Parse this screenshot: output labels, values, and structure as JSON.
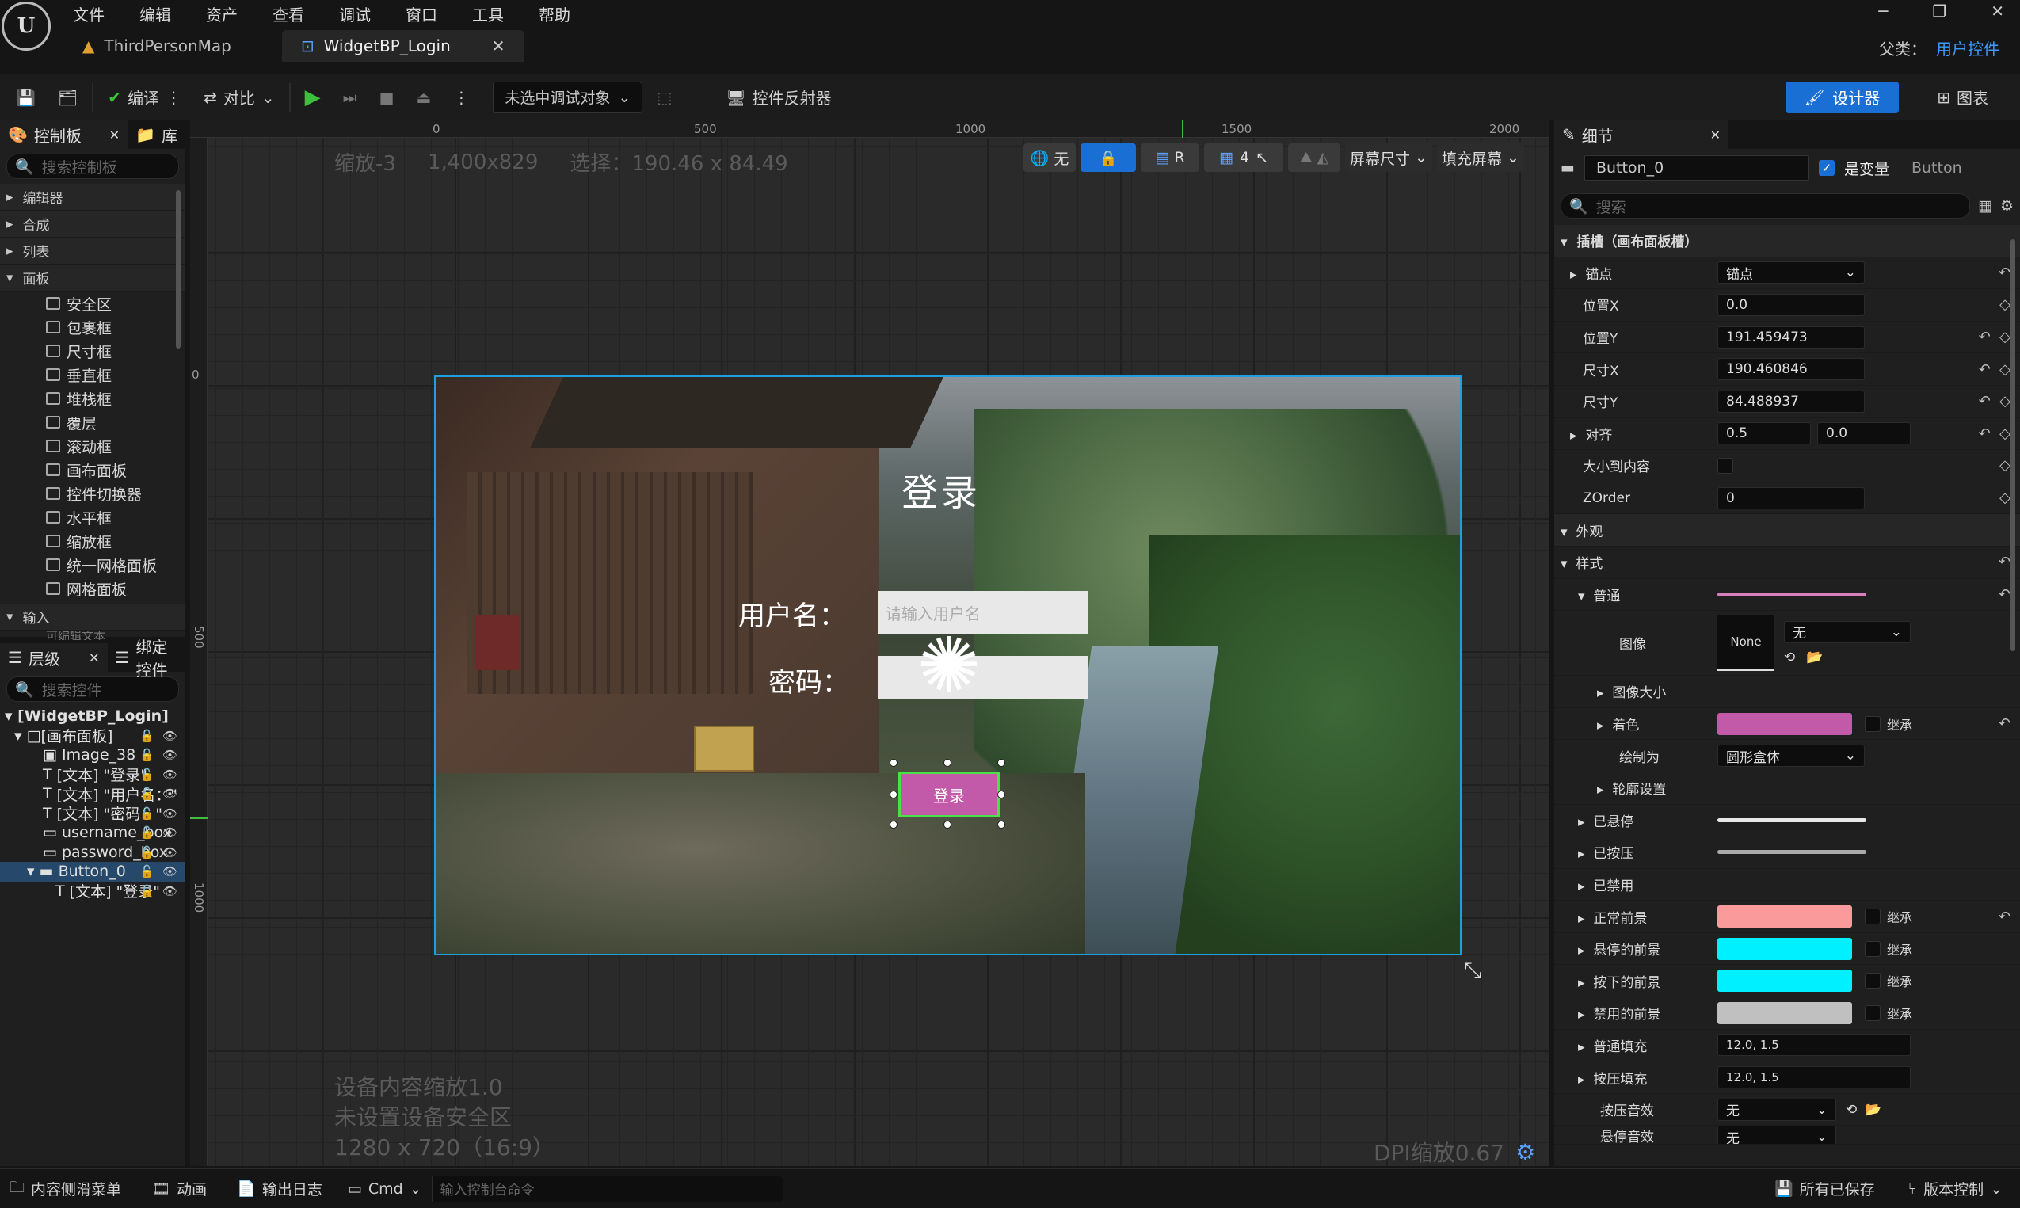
{
  "menu": [
    "文件",
    "编辑",
    "资产",
    "查看",
    "调试",
    "窗口",
    "工具",
    "帮助"
  ],
  "tabs": [
    {
      "label": "ThirdPersonMap"
    },
    {
      "label": "WidgetBP_Login"
    }
  ],
  "window": {
    "parent_label": "父类：",
    "parent_value": "用户控件"
  },
  "toolbar": {
    "compile": "编译",
    "diff": "对比",
    "debug_target": "未选中调试对象",
    "reflector": "控件反射器",
    "designer": "设计器",
    "graph": "图表"
  },
  "palette": {
    "tab": "控制板",
    "lib_tab": "库",
    "search_placeholder": "搜索控制板",
    "categories": [
      "编辑器",
      "合成",
      "列表",
      "面板"
    ],
    "items": [
      "安全区",
      "包裹框",
      "尺寸框",
      "垂直框",
      "堆栈框",
      "覆层",
      "滚动框",
      "画布面板",
      "控件切换器",
      "水平框",
      "缩放框",
      "统一网格面板",
      "网格面板"
    ],
    "input_category": "输入",
    "partial": "可编辑文本"
  },
  "hierarchy": {
    "tab": "层级",
    "bind_tab": "绑定控件",
    "search_placeholder": "搜索控件",
    "rows": [
      "[WidgetBP_Login]",
      "[画布面板]",
      "Image_38",
      "[文本] \"登录\"",
      "[文本] \"用户名：\"",
      "[文本] \"密码：\"",
      "username_box",
      "password_box",
      "Button_0",
      "[文本] \"登录\""
    ]
  },
  "viewport": {
    "zoom": "缩放-3",
    "resolution": "1,400x829",
    "selection": "选择：190.46 x 84.49",
    "tools": {
      "none": "无",
      "r": "R",
      "grid_num": "4",
      "screen_size": "屏幕尺寸",
      "fill_screen": "填充屏幕"
    },
    "ruler_x": [
      "0",
      "500",
      "1000",
      "1500",
      "2000"
    ],
    "ruler_y": [
      "0",
      "500",
      "1000"
    ],
    "device_scale": "设备内容缩放1.0",
    "safe_zone": "未设置设备安全区",
    "res_ratio": "1280 x 720（16:9）",
    "dpi": "DPI缩放0.67"
  },
  "canvas": {
    "title": "登录",
    "username_label": "用户名：",
    "password_label": "密码：",
    "username_placeholder": "请输入用户名",
    "button_text": "登录"
  },
  "details": {
    "tab": "细节",
    "widget_name": "Button_0",
    "is_variable": "是变量",
    "widget_type": "Button",
    "search_placeholder": "搜索",
    "slot_section": "插槽（画布面板槽）",
    "anchor_label": "锚点",
    "anchor_value": "锚点",
    "pos_x_label": "位置X",
    "pos_x": "0.0",
    "pos_y_label": "位置Y",
    "pos_y": "191.459473",
    "size_x_label": "尺寸X",
    "size_x": "190.460846",
    "size_y_label": "尺寸Y",
    "size_y": "84.488937",
    "align_label": "对齐",
    "align_x": "0.5",
    "align_y": "0.0",
    "autosize_label": "大小到内容",
    "zorder_label": "ZOrder",
    "zorder": "0",
    "appearance_section": "外观",
    "style_label": "样式",
    "normal_label": "普通",
    "image_label": "图像",
    "image_value": "None",
    "image_dropdown": "无",
    "image_size_label": "图像大小",
    "tint_label": "着色",
    "inherit": "继承",
    "draw_as_label": "绘制为",
    "draw_as": "圆形盒体",
    "outline_label": "轮廓设置",
    "hovered_label": "已悬停",
    "pressed_label": "已按压",
    "disabled_label": "已禁用",
    "normal_fg_label": "正常前景",
    "hover_fg_label": "悬停的前景",
    "pressed_fg_label": "按下的前景",
    "disabled_fg_label": "禁用的前景",
    "normal_pad_label": "普通填充",
    "normal_pad": "12.0, 1.5",
    "pressed_pad_label": "按压填充",
    "pressed_pad": "12.0, 1.5",
    "press_sound_label": "按压音效",
    "press_sound": "无",
    "hover_sound_label": "悬停音效",
    "hover_sound": "无",
    "colors": {
      "tint": "#c25aa9",
      "normal_fg": "#fb9a9a",
      "hover_fg": "#00f0ff",
      "pressed_fg": "#00f0ff",
      "disabled_fg": "#c0c0c0",
      "normal_line": "#d77fbf"
    }
  },
  "status": {
    "drawer": "内容侧滑菜单",
    "anim": "动画",
    "log": "输出日志",
    "cmd": "Cmd",
    "cmd_placeholder": "输入控制台命令",
    "saved": "所有已保存",
    "version": "版本控制"
  }
}
